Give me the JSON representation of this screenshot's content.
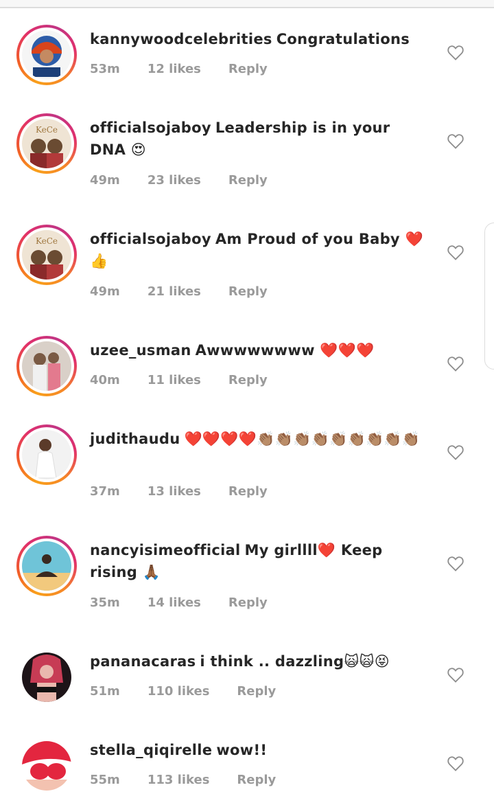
{
  "comments": [
    {
      "username": "kannywoodcelebrities",
      "text": "Congratulations",
      "time": "53m",
      "likes": "12 likes",
      "reply": "Reply",
      "avatar_colors": [
        "#f7f7f7",
        "#2d5ca8",
        "#d9441c"
      ]
    },
    {
      "username": "officialsojaboy",
      "text": "Leadership is in your DNA 😍",
      "time": "49m",
      "likes": "23 likes",
      "reply": "Reply",
      "avatar_colors": [
        "#efe4d4",
        "#8a2a2a",
        "#6a4b32"
      ]
    },
    {
      "username": "officialsojaboy",
      "text": "Am Proud of you Baby ❤️👍",
      "time": "49m",
      "likes": "21 likes",
      "reply": "Reply",
      "avatar_colors": [
        "#efe4d4",
        "#8a2a2a",
        "#6a4b32"
      ]
    },
    {
      "username": "uzee_usman",
      "text": "Awwwwwwww ❤️❤️❤️",
      "time": "40m",
      "likes": "11 likes",
      "reply": "Reply",
      "avatar_colors": [
        "#d9d0c8",
        "#7a5a44",
        "#e37a8e"
      ]
    },
    {
      "username": "judithaudu",
      "text": "❤️❤️❤️❤️👏🏽👏🏽👏🏽👏🏽👏🏽👏🏽👏🏽👏🏽👏🏽",
      "time": "37m",
      "likes": "13 likes",
      "reply": "Reply",
      "avatar_colors": [
        "#f2f2f2",
        "#e6e6e6",
        "#5b3b2a"
      ]
    },
    {
      "username": "nancyisimeofficial",
      "text": "My girllll❤️ Keep rising 🙏🏾",
      "time": "35m",
      "likes": "14 likes",
      "reply": "Reply",
      "avatar_colors": [
        "#6fc4d8",
        "#f2c97d",
        "#3a2a20"
      ]
    },
    {
      "username": "pananacaras",
      "text": "i think .. dazzling🙀🙀😝",
      "time": "51m",
      "likes": "110 likes",
      "reply": "Reply",
      "avatar_colors": [
        "#1d1418",
        "#c73c55",
        "#e9b8ae"
      ]
    },
    {
      "username": "stella_qiqirelle",
      "text": "wow!!",
      "time": "55m",
      "likes": "113 likes",
      "reply": "Reply",
      "avatar_colors": [
        "#ffffff",
        "#e3263f",
        "#f3c2b0"
      ]
    }
  ],
  "icons": {
    "like": "heart-outline-icon"
  },
  "colors": {
    "text": "#262626",
    "meta": "#9a9a9a",
    "ring_start": "#f9a01b",
    "ring_end": "#c13584"
  }
}
